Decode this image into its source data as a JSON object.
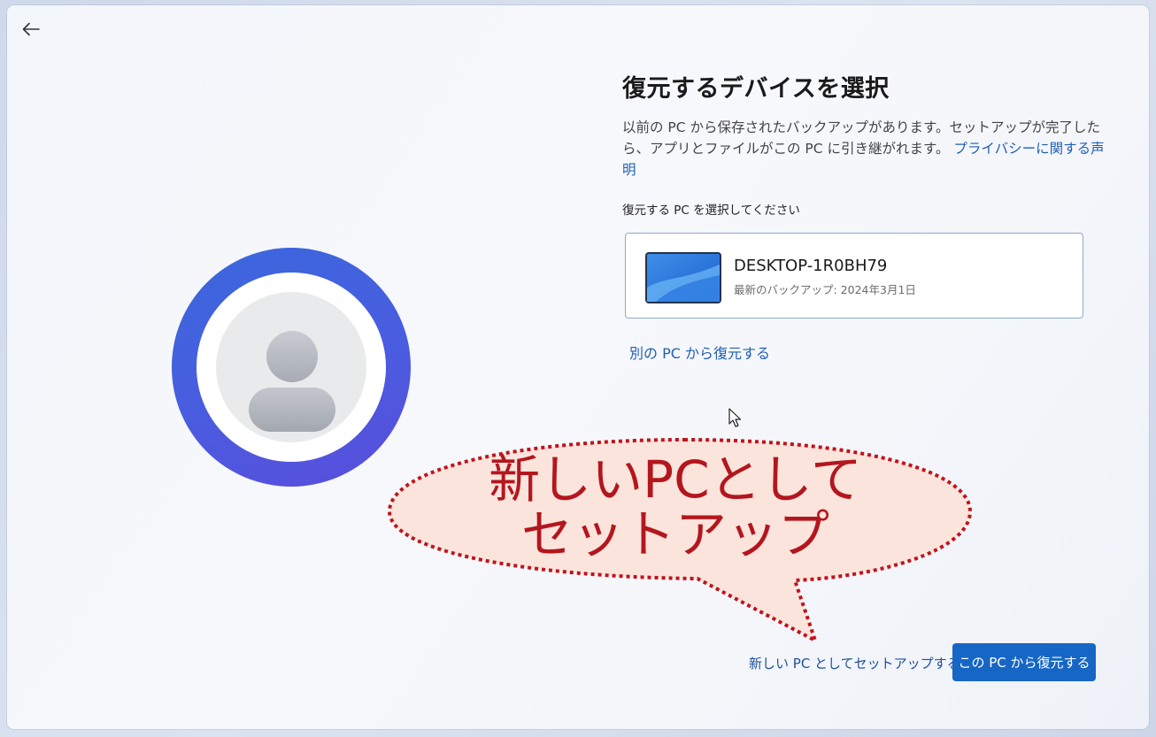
{
  "icons": {
    "back": "back-arrow-icon",
    "avatar": "user-avatar-icon",
    "pc_thumbnail": "desktop-wallpaper-icon",
    "cursor": "mouse-pointer-icon"
  },
  "colors": {
    "accent": "#1666c5",
    "link": "#1f5fb4",
    "callout_text": "#b4161e",
    "callout_fill": "#fbe4dc",
    "callout_border": "#c0141c",
    "avatar_ring": "#4a5ce0"
  },
  "main": {
    "title": "復元するデバイスを選択",
    "description_text": "以前の PC から保存されたバックアップがあります。セットアップが完了したら、アプリとファイルがこの PC に引き継がれます。",
    "privacy_link": "プライバシーに関する声明",
    "select_label": "復元する PC を選択してください",
    "pc_card": {
      "name": "DESKTOP-1R0BH79",
      "last_backup": "最新のバックアップ: 2024年3月1日"
    },
    "restore_other_link": "別の PC から復元する"
  },
  "callout": {
    "line1": "新しいPCとして",
    "line2": "セットアップ"
  },
  "footer": {
    "setup_new_link": "新しい PC としてセットアップする",
    "restore_button": "この PC から復元する"
  }
}
